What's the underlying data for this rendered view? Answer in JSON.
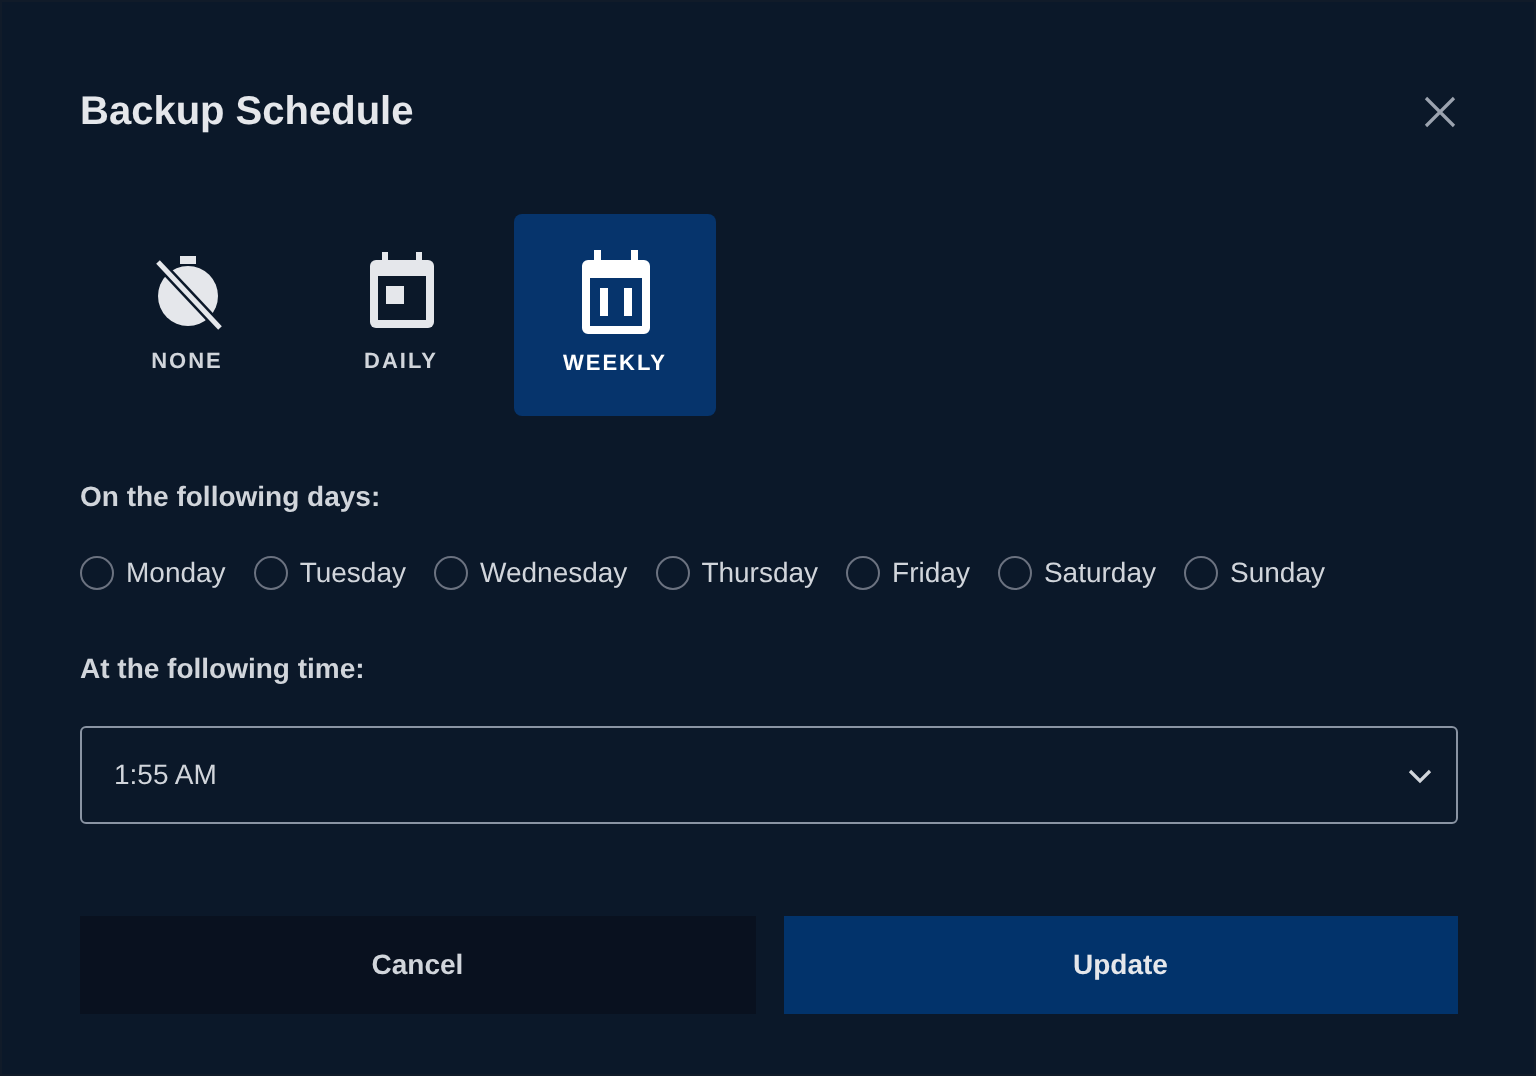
{
  "dialog": {
    "title": "Backup Schedule"
  },
  "modes": [
    {
      "kind": "none",
      "label": "NONE",
      "selected": false
    },
    {
      "kind": "daily",
      "label": "DAILY",
      "selected": false
    },
    {
      "kind": "weekly",
      "label": "WEEKLY",
      "selected": true
    }
  ],
  "days_label": "On the following days:",
  "days": [
    {
      "label": "Monday",
      "checked": false
    },
    {
      "label": "Tuesday",
      "checked": false
    },
    {
      "label": "Wednesday",
      "checked": false
    },
    {
      "label": "Thursday",
      "checked": false
    },
    {
      "label": "Friday",
      "checked": false
    },
    {
      "label": "Saturday",
      "checked": false
    },
    {
      "label": "Sunday",
      "checked": false
    }
  ],
  "time_label": "At the following time:",
  "time_select": {
    "value": "1:55 AM"
  },
  "buttons": [
    {
      "kind": "secondary",
      "label": "Cancel"
    },
    {
      "kind": "primary",
      "label": "Update"
    }
  ]
}
